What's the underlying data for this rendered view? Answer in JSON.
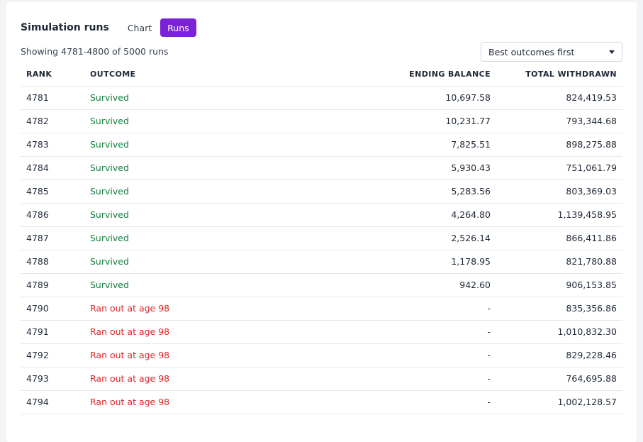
{
  "header": {
    "title": "Simulation runs",
    "tabs": [
      {
        "label": "Chart",
        "active": false
      },
      {
        "label": "Runs",
        "active": true
      }
    ]
  },
  "summary": "Showing 4781-4800 of 5000 runs",
  "sort": {
    "selected": "Best outcomes first"
  },
  "colors": {
    "accent": "#7c22d6",
    "survived": "#15803d",
    "ran_out": "#dc2626"
  },
  "table": {
    "columns": [
      "RANK",
      "OUTCOME",
      "ENDING BALANCE",
      "TOTAL WITHDRAWN"
    ],
    "rows": [
      {
        "rank": "4781",
        "outcome": "Survived",
        "status": "ok",
        "ending": "10,697.58",
        "total": "824,419.53"
      },
      {
        "rank": "4782",
        "outcome": "Survived",
        "status": "ok",
        "ending": "10,231.77",
        "total": "793,344.68"
      },
      {
        "rank": "4783",
        "outcome": "Survived",
        "status": "ok",
        "ending": "7,825.51",
        "total": "898,275.88"
      },
      {
        "rank": "4784",
        "outcome": "Survived",
        "status": "ok",
        "ending": "5,930.43",
        "total": "751,061.79"
      },
      {
        "rank": "4785",
        "outcome": "Survived",
        "status": "ok",
        "ending": "5,283.56",
        "total": "803,369.03"
      },
      {
        "rank": "4786",
        "outcome": "Survived",
        "status": "ok",
        "ending": "4,264.80",
        "total": "1,139,458.95"
      },
      {
        "rank": "4787",
        "outcome": "Survived",
        "status": "ok",
        "ending": "2,526.14",
        "total": "866,411.86"
      },
      {
        "rank": "4788",
        "outcome": "Survived",
        "status": "ok",
        "ending": "1,178.95",
        "total": "821,780.88"
      },
      {
        "rank": "4789",
        "outcome": "Survived",
        "status": "ok",
        "ending": "942.60",
        "total": "906,153.85"
      },
      {
        "rank": "4790",
        "outcome": "Ran out at age 98",
        "status": "bad",
        "ending": "-",
        "total": "835,356.86"
      },
      {
        "rank": "4791",
        "outcome": "Ran out at age 98",
        "status": "bad",
        "ending": "-",
        "total": "1,010,832.30"
      },
      {
        "rank": "4792",
        "outcome": "Ran out at age 98",
        "status": "bad",
        "ending": "-",
        "total": "829,228.46"
      },
      {
        "rank": "4793",
        "outcome": "Ran out at age 98",
        "status": "bad",
        "ending": "-",
        "total": "764,695.88"
      },
      {
        "rank": "4794",
        "outcome": "Ran out at age 98",
        "status": "bad",
        "ending": "-",
        "total": "1,002,128.57"
      }
    ]
  }
}
